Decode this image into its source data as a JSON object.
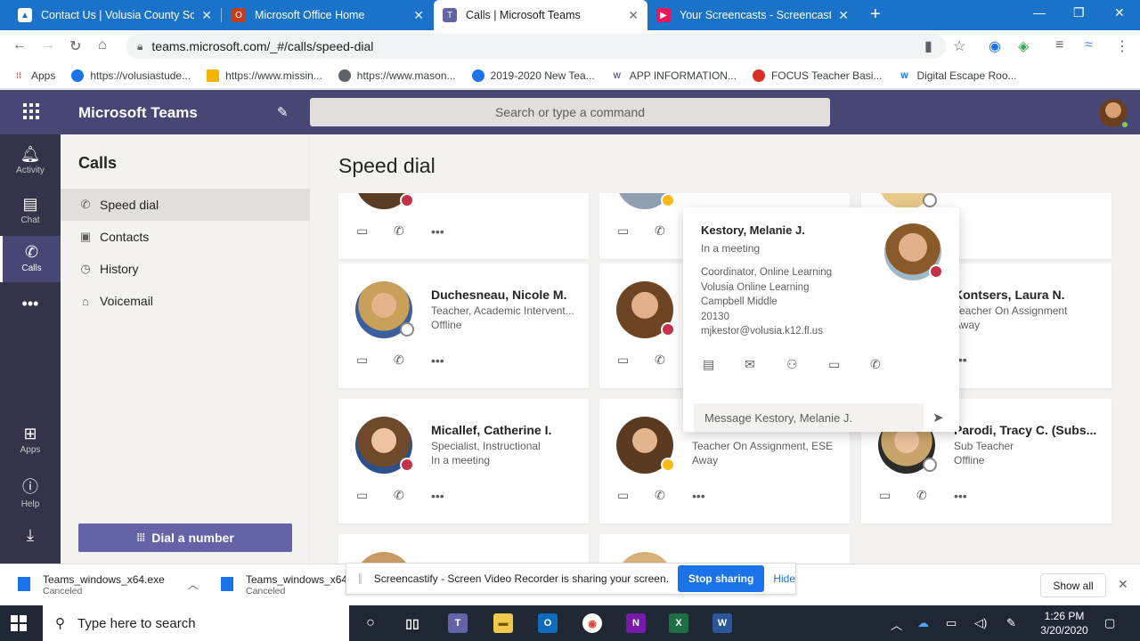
{
  "browser": {
    "tabs": [
      {
        "title": "Contact Us | Volusia County Scho",
        "color": "#1a73c8"
      },
      {
        "title": "Microsoft Office Home",
        "color": "#c43e1c"
      },
      {
        "title": "Calls | Microsoft Teams",
        "color": "#6264a7"
      },
      {
        "title": "Your Screencasts - Screencastify",
        "color": "#e8175d"
      }
    ],
    "url": "teams.microsoft.com/_#/calls/speed-dial",
    "bookmarks": [
      {
        "label": "Apps"
      },
      {
        "label": "https://volusiastude..."
      },
      {
        "label": "https://www.missin..."
      },
      {
        "label": "https://www.mason..."
      },
      {
        "label": "2019-2020 New Tea..."
      },
      {
        "label": "APP INFORMATION..."
      },
      {
        "label": "FOCUS Teacher Basi..."
      },
      {
        "label": "Digital Escape Roo..."
      }
    ]
  },
  "teams": {
    "app_title": "Microsoft Teams",
    "search_placeholder": "Search or type a command",
    "rail": [
      {
        "label": "Activity"
      },
      {
        "label": "Chat"
      },
      {
        "label": "Calls"
      },
      {
        "label": "Apps"
      },
      {
        "label": "Help"
      }
    ],
    "calls": {
      "title": "Calls",
      "nav": [
        {
          "label": "Speed dial"
        },
        {
          "label": "Contacts"
        },
        {
          "label": "History"
        },
        {
          "label": "Voicemail"
        }
      ],
      "dial_button": "Dial a number"
    },
    "speed_dial": {
      "title": "Speed dial",
      "contacts": [
        {
          "name": "Duchesneau, Nicole M.",
          "title": "Teacher, Academic Intervent...",
          "status": "Offline"
        },
        {
          "name": "Kontsers, Laura N.",
          "title": "Teacher On Assignment",
          "status": "Away"
        },
        {
          "name": "Micallef, Catherine I.",
          "title": "Specialist, Instructional",
          "status": "In a meeting"
        },
        {
          "name": "",
          "title": "Teacher On Assignment, ESE",
          "status": "Away"
        },
        {
          "name": "Parodi, Tracy C. (Subs...",
          "title": "Sub Teacher",
          "status": "Offline"
        }
      ]
    },
    "profile_card": {
      "name": "Kestory, Melanie J.",
      "status": "In a meeting",
      "job": "Coordinator, Online Learning",
      "dept": "Volusia Online Learning",
      "office": "Campbell Middle",
      "zip": "20130",
      "email": "mjkestor@volusia.k12.fl.us",
      "message_placeholder": "Message Kestory, Melanie J."
    }
  },
  "downloads": [
    {
      "file": "Teams_windows_x64.exe",
      "state": "Canceled"
    },
    {
      "file": "Teams_windows_x64.e",
      "state": "Canceled"
    }
  ],
  "show_all": "Show all",
  "screencastify": {
    "message": "Screencastify - Screen Video Recorder is sharing your screen.",
    "stop": "Stop sharing",
    "hide": "Hide"
  },
  "taskbar": {
    "search_placeholder": "Type here to search",
    "time": "1:26 PM",
    "date": "3/20/2020"
  }
}
